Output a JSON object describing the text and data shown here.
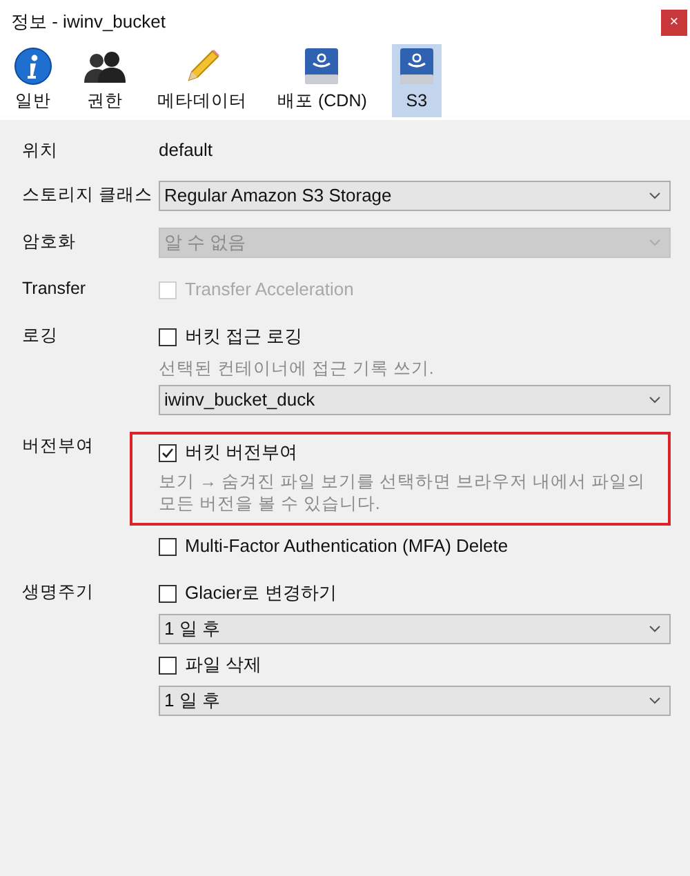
{
  "window": {
    "title": "정보 - iwinv_bucket",
    "close": "×"
  },
  "tabs": [
    {
      "label": "일반",
      "kind": "info",
      "selected": false
    },
    {
      "label": "권한",
      "kind": "users",
      "selected": false
    },
    {
      "label": "메타데이터",
      "kind": "pencil",
      "selected": false
    },
    {
      "label": "배포 (CDN)",
      "kind": "drive",
      "selected": false
    },
    {
      "label": "S3",
      "kind": "drive",
      "selected": true
    }
  ],
  "rows": [
    {
      "label": "위치",
      "controls": [
        {
          "kind": "value",
          "text": "default"
        }
      ]
    },
    {
      "label": "스토리지 클래스",
      "controls": [
        {
          "kind": "select",
          "value": "Regular Amazon S3 Storage",
          "disabled": false
        }
      ]
    },
    {
      "label": "암호화",
      "controls": [
        {
          "kind": "select",
          "value": "알 수 없음",
          "disabled": true
        }
      ]
    },
    {
      "label": "Transfer",
      "controls": [
        {
          "kind": "checkbox",
          "text": "Transfer Acceleration",
          "checked": false,
          "disabled": true
        }
      ]
    },
    {
      "label": "로깅",
      "controls": [
        {
          "kind": "checkbox",
          "text": "버킷 접근 로깅",
          "checked": false,
          "disabled": false
        },
        {
          "kind": "hint",
          "text": "선택된 컨테이너에 접근 기록 쓰기."
        },
        {
          "kind": "select",
          "value": "iwinv_bucket_duck",
          "disabled": false
        }
      ]
    },
    {
      "label": "버전부여",
      "controls": [
        {
          "kind": "highlight",
          "children": [
            {
              "kind": "checkbox",
              "text": "버킷 버전부여",
              "checked": true,
              "disabled": false
            },
            {
              "kind": "hint",
              "text": "보기 → 숨겨진 파일 보기를 선택하면 브라우저 내에서 파일의 모든 버전을 볼 수 있습니다."
            }
          ]
        },
        {
          "kind": "checkbox",
          "text": "Multi-Factor Authentication (MFA) Delete",
          "checked": false,
          "disabled": false
        }
      ]
    },
    {
      "label": "생명주기",
      "controls": [
        {
          "kind": "checkbox",
          "text": "Glacier로 변경하기",
          "checked": false,
          "disabled": false
        },
        {
          "kind": "select",
          "value": "1 일 후",
          "disabled": false
        },
        {
          "kind": "checkbox",
          "text": "파일 삭제",
          "checked": false,
          "disabled": false
        },
        {
          "kind": "select",
          "value": "1 일 후",
          "disabled": false
        }
      ]
    }
  ]
}
